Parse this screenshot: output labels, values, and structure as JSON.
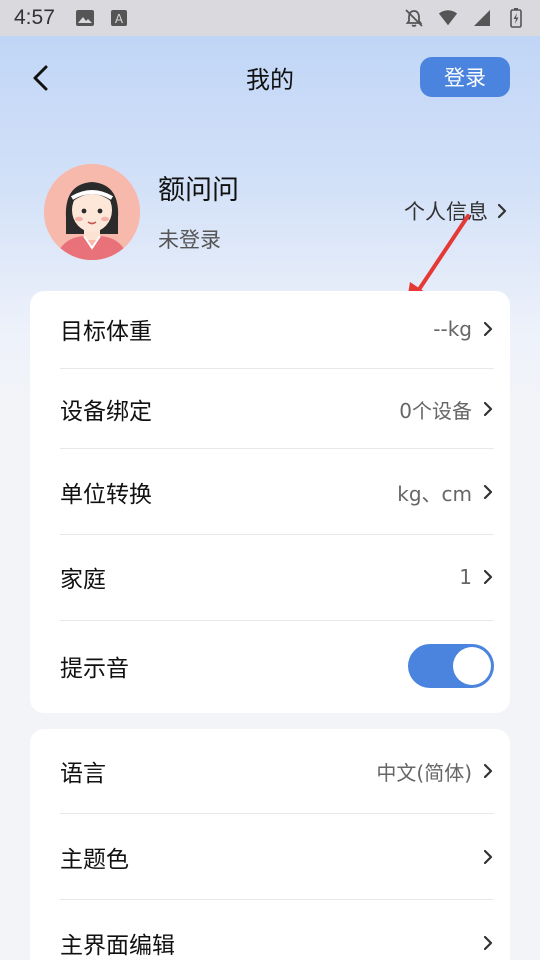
{
  "status_bar": {
    "time": "4:57"
  },
  "header": {
    "title": "我的",
    "login_label": "登录"
  },
  "profile": {
    "name": "额问问",
    "status": "未登录",
    "personal_info_label": "个人信息"
  },
  "settings_group1": [
    {
      "label": "目标体重",
      "value": "--kg"
    },
    {
      "label": "设备绑定",
      "value": "0个设备"
    },
    {
      "label": "单位转换",
      "value": "kg、cm"
    },
    {
      "label": "家庭",
      "value": "1"
    },
    {
      "label": "提示音",
      "toggle": true
    }
  ],
  "settings_group2": [
    {
      "label": "语言",
      "value": "中文(简体)"
    },
    {
      "label": "主题色",
      "value": ""
    },
    {
      "label": "主界面编辑",
      "value": ""
    }
  ],
  "colors": {
    "accent": "#4a84de",
    "annotation_arrow": "#e53935"
  },
  "icons": [
    "back-arrow-icon",
    "chevron-right-icon",
    "image-icon",
    "a-box-icon",
    "bell-off-icon",
    "wifi-icon",
    "signal-icon",
    "battery-charging-icon"
  ]
}
